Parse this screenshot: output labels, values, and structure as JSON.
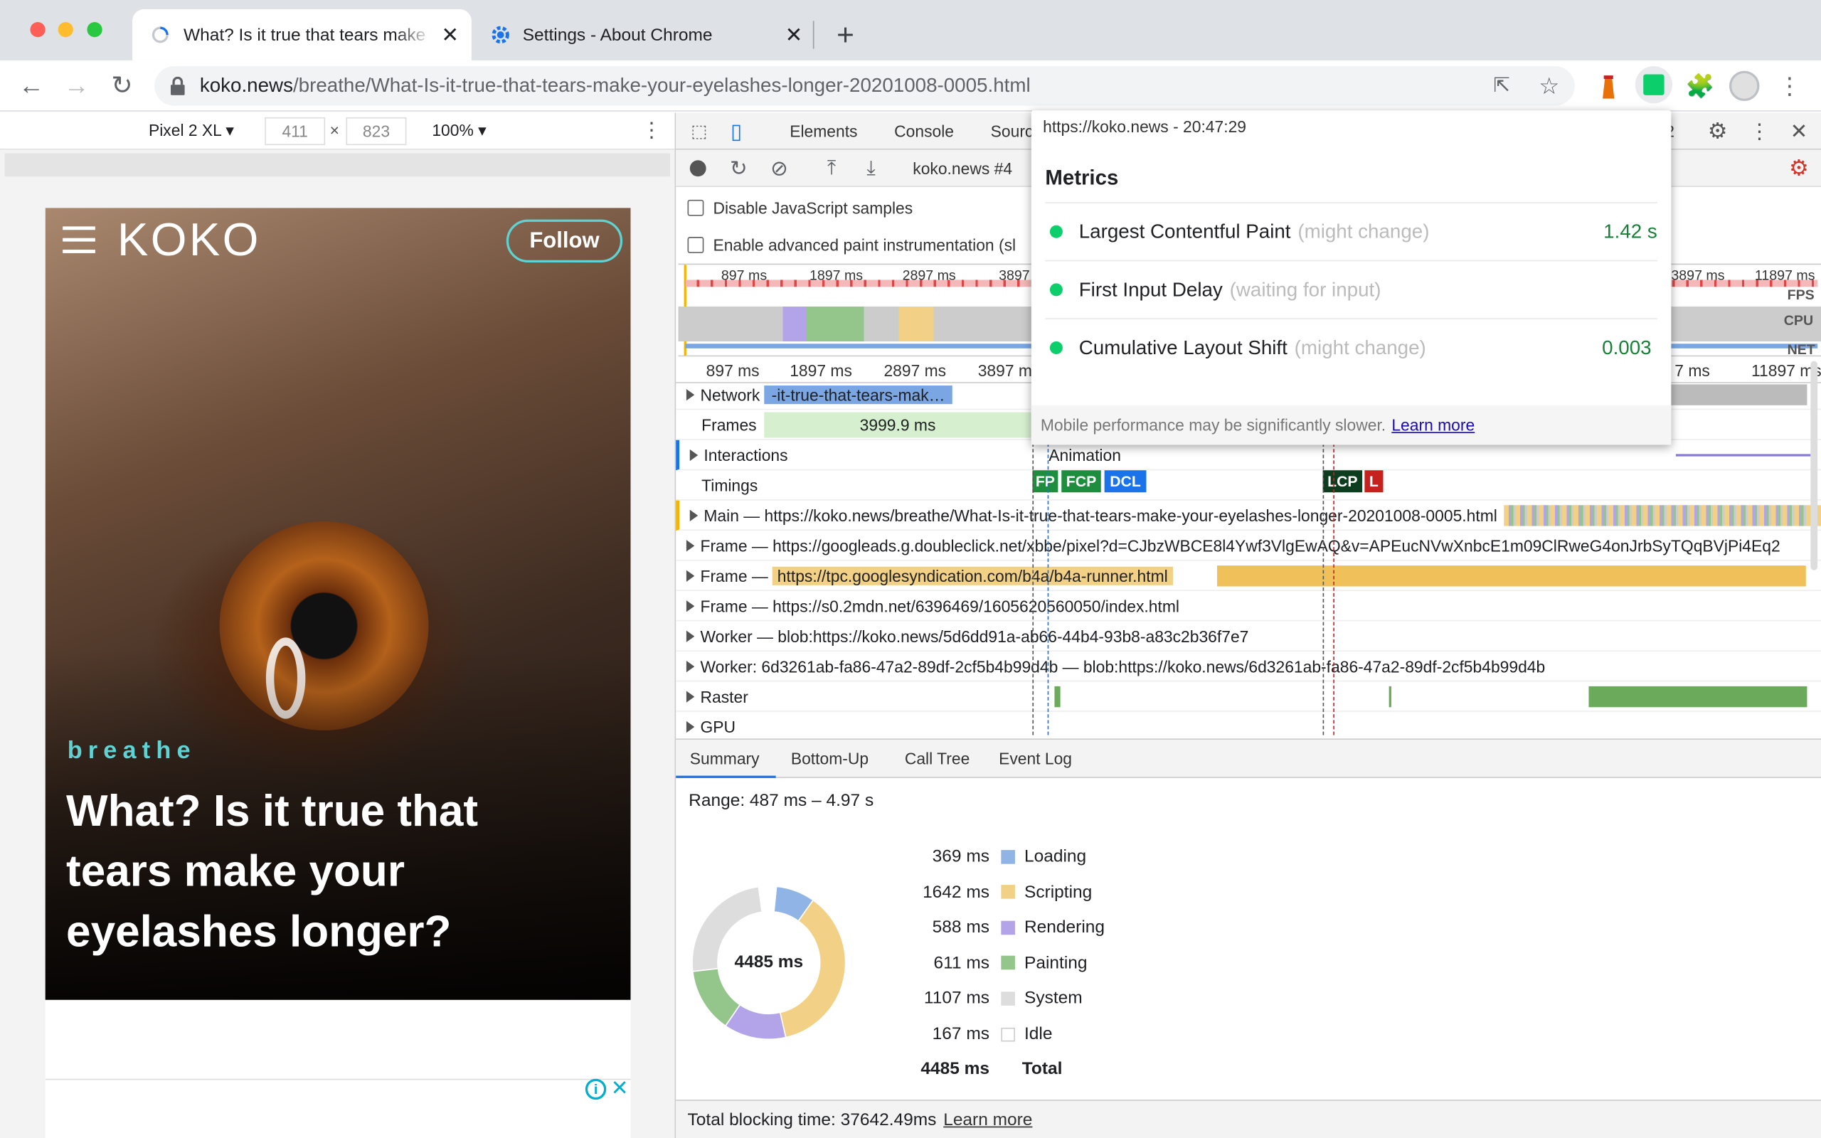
{
  "browser": {
    "tabs": [
      {
        "title": "What? Is it true that tears make your eyelashes longer?"
      },
      {
        "title": "Settings - About Chrome"
      }
    ],
    "url_host": "koko.news",
    "url_path": "/breathe/What-Is-it-true-that-tears-make-your-eyelashes-longer-20201008-0005.html",
    "colors": {
      "tabbar": "#dee1e6",
      "red": "#ff5f57",
      "yellow": "#febc2e",
      "green": "#28c840"
    }
  },
  "device": {
    "model": "Pixel 2 XL ▾",
    "width": "411",
    "height": "823",
    "times": "×",
    "zoom": "100% ▾"
  },
  "page": {
    "brand": "KOKO",
    "follow": "Follow",
    "category": "breathe",
    "headline": "What? Is it true that tears make your eyelashes longer?"
  },
  "devtools": {
    "tabs": [
      "Elements",
      "Console",
      "Sourc"
    ],
    "badge": "2",
    "recording": "koko.news #4",
    "checkbox1": "Disable JavaScript samples",
    "checkbox2": "Enable advanced paint instrumentation (sl",
    "overview_ticks": [
      "897 ms",
      "1897 ms",
      "2897 ms",
      "3897",
      "3897 ms",
      "11897 ms"
    ],
    "overview_labels": {
      "fps": "FPS",
      "cpu": "CPU",
      "net": "NET"
    },
    "ruler_ticks": [
      "897 ms",
      "1897 ms",
      "2897 ms",
      "3897 ms",
      "7 ms",
      "11897 ms"
    ],
    "tracks": {
      "network": "Network",
      "network_req": "-it-true-that-tears-mak…",
      "frames": "Frames",
      "frames_val": "3999.9 ms",
      "interactions": "Interactions",
      "animation": "Animation",
      "timings": "Timings",
      "fp": "FP",
      "fcp": "FCP",
      "dcl": "DCL",
      "lcp": "LCP",
      "l": "L",
      "main": "Main — https://koko.news/breathe/What-Is-it-true-that-tears-make-your-eyelashes-longer-20201008-0005.html",
      "frame1": "Frame — https://googleads.g.doubleclick.net/xbbe/pixel?d=CJbzWBCE8l4Ywf3VlgEwAQ&v=APEucNVwXnbcE1m09ClRweG4onJrbSyTQqBVjPi4Eq2",
      "frame2_pre": "Frame —",
      "frame2_url": "https://tpc.googlesyndication.com/b4a/b4a-runner.html",
      "frame3": "Frame — https://s0.2mdn.net/6396469/1605620560050/index.html",
      "worker1": "Worker — blob:https://koko.news/5d6dd91a-ab66-44b4-93b8-a83c2b36f7e7",
      "worker2": "Worker: 6d3261ab-fa86-47a2-89df-2cf5b4b99d4b — blob:https://koko.news/6d3261ab-fa86-47a2-89df-2cf5b4b99d4b",
      "raster": "Raster",
      "gpu": "GPU"
    },
    "popup": {
      "header": "https://koko.news - 20:47:29",
      "title": "Metrics",
      "lcp_name": "Largest Contentful Paint",
      "lcp_note": "(might change)",
      "lcp_val": "1.42 s",
      "fid_name": "First Input Delay",
      "fid_note": "(waiting for input)",
      "cls_name": "Cumulative Layout Shift",
      "cls_note": "(might change)",
      "cls_val": "0.003",
      "footer": "Mobile performance may be significantly slower.",
      "footer_link": "Learn more"
    },
    "bottom_tabs": [
      "Summary",
      "Bottom-Up",
      "Call Tree",
      "Event Log"
    ],
    "range": "Range: 487 ms – 4.97 s",
    "donut_total": "4485 ms",
    "summary": [
      {
        "time": "369 ms",
        "label": "Loading",
        "color": "#8fb4e5",
        "value": 369
      },
      {
        "time": "1642 ms",
        "label": "Scripting",
        "color": "#f2d187",
        "value": 1642
      },
      {
        "time": "588 ms",
        "label": "Rendering",
        "color": "#b3a3e8",
        "value": 588
      },
      {
        "time": "611 ms",
        "label": "Painting",
        "color": "#94c58a",
        "value": 611
      },
      {
        "time": "1107 ms",
        "label": "System",
        "color": "#dddddd",
        "value": 1107
      },
      {
        "time": "167 ms",
        "label": "Idle",
        "color": "#ffffff",
        "value": 167
      }
    ],
    "total_time": "4485 ms",
    "total_label": "Total",
    "blocking": "Total blocking time: 37642.49ms",
    "blocking_link": "Learn more"
  }
}
